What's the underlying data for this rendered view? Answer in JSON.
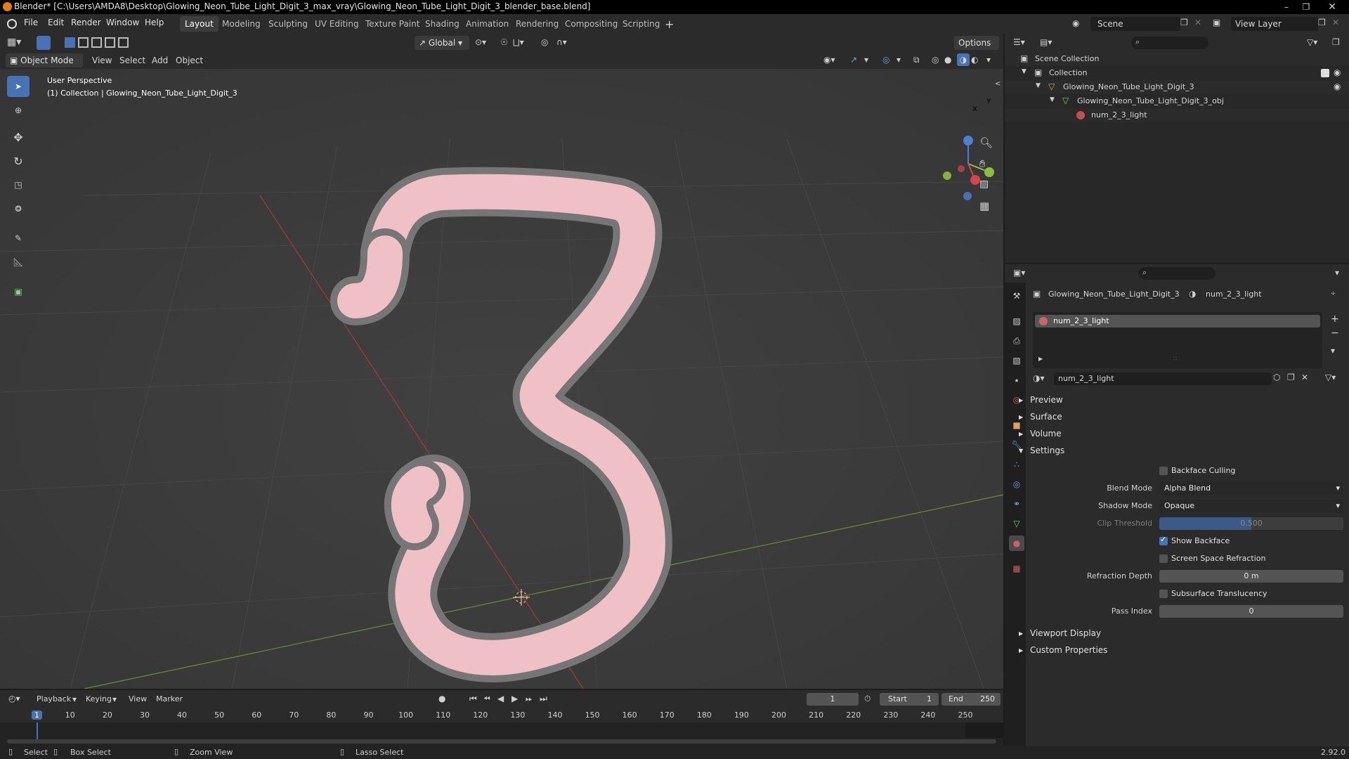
{
  "window": {
    "title": "Blender* [C:\\Users\\AMDA8\\Desktop\\Glowing_Neon_Tube_Light_Digit_3_max_vray\\Glowing_Neon_Tube_Light_Digit_3_blender_base.blend]"
  },
  "menu": [
    "File",
    "Edit",
    "Render",
    "Window",
    "Help"
  ],
  "workspaces": [
    "Layout",
    "Modeling",
    "Sculpting",
    "UV Editing",
    "Texture Paint",
    "Shading",
    "Animation",
    "Rendering",
    "Compositing",
    "Scripting"
  ],
  "workspace_active": "Layout",
  "scene": {
    "label": "Scene",
    "view_layer": "View Layer"
  },
  "viewport_header": {
    "mode": "Object Mode",
    "menus": [
      "View",
      "Select",
      "Add",
      "Object"
    ],
    "transform_orientation": "Global",
    "options": "Options"
  },
  "viewport": {
    "view_name": "User Perspective",
    "collection_info": "(1) Collection | Glowing_Neon_Tube_Light_Digit_3",
    "axis_labels": {
      "x": "X",
      "y": "Y",
      "z": "Z"
    }
  },
  "outliner": {
    "root": "Scene Collection",
    "collection": "Collection",
    "object": "Glowing_Neon_Tube_Light_Digit_3",
    "mesh": "Glowing_Neon_Tube_Light_Digit_3_obj",
    "material": "num_2_3_light"
  },
  "properties": {
    "breadcrumb_object": "Glowing_Neon_Tube_Light_Digit_3",
    "breadcrumb_material": "num_2_3_light",
    "slot_name": "num_2_3_light",
    "material_name": "num_2_3_light",
    "panels": {
      "preview": "Preview",
      "surface": "Surface",
      "volume": "Volume",
      "settings": "Settings",
      "viewport_display": "Viewport Display",
      "custom_properties": "Custom Properties"
    },
    "settings": {
      "backface_culling": {
        "label": "Backface Culling",
        "checked": false
      },
      "blend_mode": {
        "label": "Blend Mode",
        "value": "Alpha Blend"
      },
      "shadow_mode": {
        "label": "Shadow Mode",
        "value": "Opaque"
      },
      "clip_threshold": {
        "label": "Clip Threshold",
        "value": "0.500",
        "fraction": 0.5
      },
      "show_backface": {
        "label": "Show Backface",
        "checked": true
      },
      "screen_space_refraction": {
        "label": "Screen Space Refraction",
        "checked": false
      },
      "refraction_depth": {
        "label": "Refraction Depth",
        "value": "0 m"
      },
      "subsurface_translucency": {
        "label": "Subsurface Translucency",
        "checked": false
      },
      "pass_index": {
        "label": "Pass Index",
        "value": "0"
      }
    }
  },
  "timeline": {
    "menus": [
      "Playback",
      "Keying",
      "View",
      "Marker"
    ],
    "current_frame": "1",
    "start_label": "Start",
    "start": "1",
    "end_label": "End",
    "end": "250",
    "ticks": [
      "1",
      "10",
      "20",
      "30",
      "40",
      "50",
      "60",
      "70",
      "80",
      "90",
      "100",
      "110",
      "120",
      "130",
      "140",
      "150",
      "160",
      "170",
      "180",
      "190",
      "200",
      "210",
      "220",
      "230",
      "240",
      "250"
    ]
  },
  "statusbar": {
    "select": "Select",
    "box_select": "Box Select",
    "zoom_view": "Zoom View",
    "lasso_select": "Lasso Select",
    "version": "2.92.0"
  },
  "colors": {
    "accent": "#4772b3",
    "viewport_bg": "#3c3c3c",
    "neon_fill": "#f3c6cc",
    "neon_outline": "#7a7a7a"
  }
}
